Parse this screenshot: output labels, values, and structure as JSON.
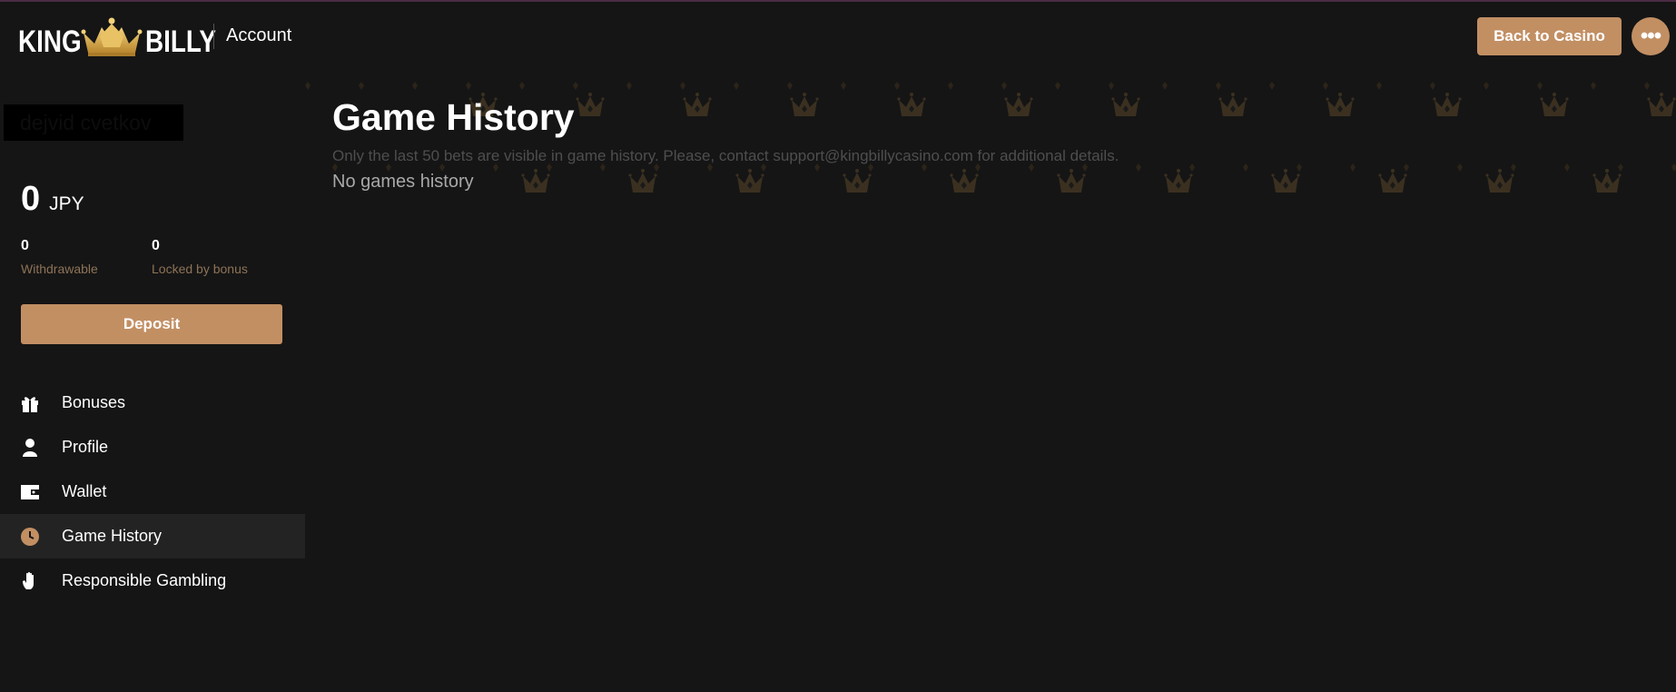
{
  "header": {
    "logo_left": "KING",
    "logo_right": "BILLY",
    "title": "Account",
    "back_button": "Back to Casino",
    "more_icon": "more-dots-icon"
  },
  "sidebar": {
    "username": "dejvid cvetkov",
    "balance": {
      "amount": "0",
      "currency": "JPY"
    },
    "withdrawable": {
      "value": "0",
      "label": "Withdrawable"
    },
    "locked": {
      "value": "0",
      "label": "Locked by bonus"
    },
    "deposit_button": "Deposit",
    "nav": [
      {
        "label": "Bonuses",
        "icon": "gift-icon"
      },
      {
        "label": "Profile",
        "icon": "user-icon"
      },
      {
        "label": "Wallet",
        "icon": "wallet-icon"
      },
      {
        "label": "Game History",
        "icon": "clock-icon",
        "active": true
      },
      {
        "label": "Responsible Gambling",
        "icon": "hand-icon"
      }
    ]
  },
  "main": {
    "title": "Game History",
    "info": "Only the last 50 bets are visible in game history. Please, contact support@kingbillycasino.com for additional details.",
    "empty": "No games history"
  },
  "colors": {
    "accent": "#c28f63",
    "background": "#151515",
    "active_nav": "#232323",
    "muted_label": "#8d7357"
  }
}
